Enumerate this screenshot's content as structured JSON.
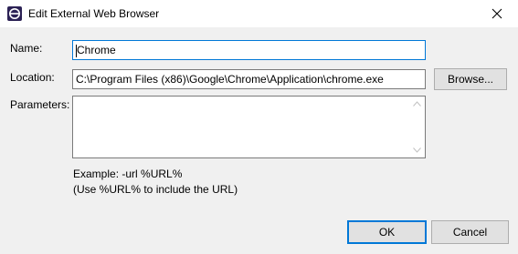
{
  "window": {
    "title": "Edit External Web Browser",
    "close_icon": "close-icon",
    "app_icon": "eclipse-icon"
  },
  "form": {
    "name_label": "Name:",
    "name_value": "Chrome",
    "location_label": "Location:",
    "location_value": "C:\\Program Files (x86)\\Google\\Chrome\\Application\\chrome.exe",
    "browse_label": "Browse...",
    "parameters_label": "Parameters:",
    "parameters_value": ""
  },
  "help": {
    "line1": "Example: -url %URL%",
    "line2": "(Use %URL% to include the URL)"
  },
  "buttons": {
    "ok_label": "OK",
    "cancel_label": "Cancel"
  },
  "colors": {
    "focus": "#0078d7",
    "dialog_bg": "#f0f0f0"
  }
}
